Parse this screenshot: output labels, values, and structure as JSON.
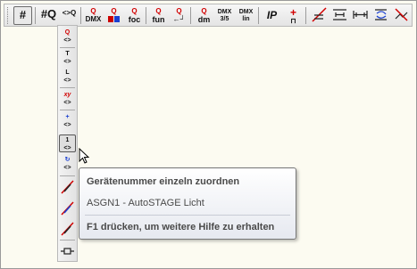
{
  "toolbar": {
    "buttons": [
      {
        "name": "hash",
        "label": "#"
      },
      {
        "name": "hash-q",
        "label": "#Q"
      },
      {
        "name": "q-compare",
        "label": "<>Q"
      },
      {
        "name": "dmx-q",
        "label": "DMX"
      },
      {
        "name": "color-q",
        "label": "Q"
      },
      {
        "name": "focus-q",
        "label": "foc"
      },
      {
        "name": "fun-q",
        "label": "fun"
      },
      {
        "name": "q-arrows",
        "label": "Q"
      },
      {
        "name": "dm-q",
        "label": "dm"
      },
      {
        "name": "dmx-35",
        "label": "DMX 3/5"
      },
      {
        "name": "dmx-lin",
        "label": "DMX lin"
      },
      {
        "name": "ip",
        "label": "IP"
      },
      {
        "name": "add-plus",
        "label": "+"
      }
    ]
  },
  "vbar": {
    "buttons": [
      {
        "label": "<>",
        "sup": "Q"
      },
      {
        "label": "<>",
        "sup": "T"
      },
      {
        "label": "<>",
        "sup": "L"
      },
      {
        "label": "<>",
        "sup": "xy"
      },
      {
        "label": "<>",
        "sup": "+"
      },
      {
        "label": "<>",
        "sup": "1"
      },
      {
        "label": "<>",
        "sup": "↻"
      }
    ]
  },
  "tooltip": {
    "title": "Gerätenummer einzeln zuordnen",
    "body": "ASGN1 - AutoSTAGE Licht",
    "help": "F1 drücken, um weitere Hilfe zu erhalten"
  },
  "colors": {
    "accent": "#d10000",
    "background": "#fcfbf1"
  }
}
